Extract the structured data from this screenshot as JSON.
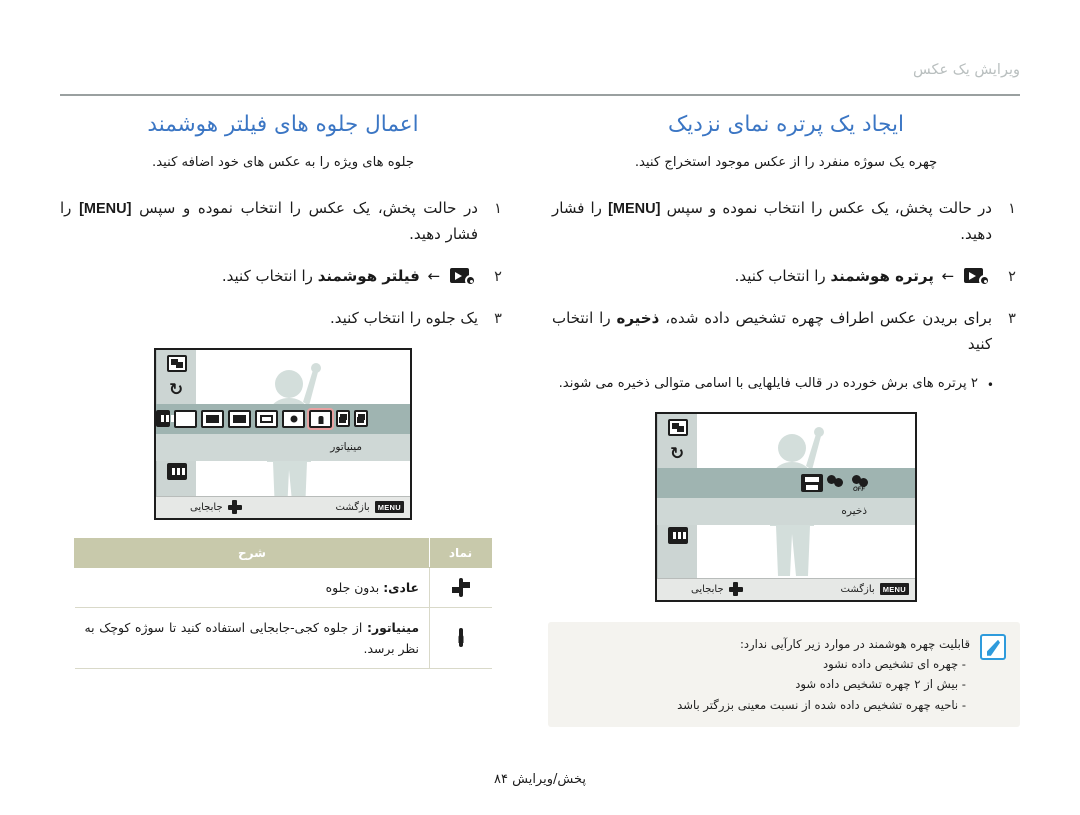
{
  "header": {
    "running_head": "ویرایش یک عکس"
  },
  "right_column": {
    "title": "ایجاد یک پرتره نمای نزدیک",
    "lede": "چهره یک سوژه منفرد را از عکس موجود استخراج کنید.",
    "steps": [
      {
        "num": "۱",
        "text_before": "در حالت پخش، یک عکس را انتخاب نموده و سپس",
        "kbd": "[MENU]",
        "text_after": "را فشار دهید."
      },
      {
        "num": "۲",
        "icon": "play-edit-icon",
        "arrow": "←",
        "bold": "پرتره هوشمند",
        "text_after": "را انتخاب کنید."
      },
      {
        "num": "۳",
        "text_before": "برای بریدن عکس اطراف چهره تشخیص داده شده،",
        "bold": "ذخیره",
        "text_after": "را انتخاب کنید"
      }
    ],
    "sub_bullets": [
      "۲ پرتره های برش خورده در قالب فایلهایی با اسامی متوالی ذخیره می شوند."
    ],
    "lcd": {
      "rail_icons": [
        "crop-icon",
        "rotate-icon",
        "smart-face-icon",
        "smart-filter-icon",
        "piano-icon"
      ],
      "strip_icons": [
        "smart-face-off-icon",
        "smart-face-icon",
        "save-icon"
      ],
      "selected_label": "ذخیره",
      "bottom_left_label": "بازگشت",
      "bottom_left_key": "MENU",
      "bottom_right_label": "جابجایی",
      "bottom_right_key": "dpad-icon"
    },
    "note": {
      "icon": "note-pen-icon",
      "heading": "قابلیت چهره هوشمند در موارد زیر کارآیی ندارد:",
      "items": [
        "- چهره ای تشخیص داده نشود",
        "- بیش از ۲ چهره تشخیص داده شود",
        "- ناحیه چهره تشخیص داده شده از نسبت معینی بزرگتر باشد"
      ]
    }
  },
  "left_column": {
    "title": "اعمال جلوه های فیلتر هوشمند",
    "lede": "جلوه های ویژه را به عکس های خود اضافه کنید.",
    "steps": [
      {
        "num": "۱",
        "text_before": "در حالت پخش، یک عکس را انتخاب نموده و سپس",
        "kbd": "[MENU]",
        "text_after": "را فشار دهید."
      },
      {
        "num": "۲",
        "icon": "play-edit-icon",
        "arrow": "←",
        "bold": "فیلتر هوشمند",
        "text_after": "را انتخاب کنید."
      },
      {
        "num": "۳",
        "text_before": "یک جلوه را انتخاب کنید.",
        "bold": "",
        "text_after": ""
      }
    ],
    "lcd": {
      "rail_icons": [
        "crop-icon",
        "rotate-icon",
        "smart-face-off-icon",
        "smart-filter-off-icon",
        "piano-icon"
      ],
      "strip_icons": [
        "normal-icon",
        "smart-filter-off-icon",
        "miniature-icon",
        "vignetting-icon",
        "soft-focus-icon",
        "old-film1-icon",
        "old-film2-icon",
        "half-tone-icon",
        "classic-icon"
      ],
      "selected_label": "مینیاتور",
      "bottom_left_label": "بازگشت",
      "bottom_left_key": "MENU",
      "bottom_right_label": "جابجایی",
      "bottom_right_key": "dpad-icon"
    },
    "table": {
      "headers": {
        "symbol": "نماد",
        "description": "شرح"
      },
      "rows": [
        {
          "symbol": "normal-icon",
          "bold": "عادی:",
          "desc": "بدون جلوه"
        },
        {
          "symbol": "miniature-icon",
          "bold": "مینیاتور:",
          "desc": "از جلوه کجی-جابجایی استفاده کنید تا سوژه کوچک به نظر برسد."
        }
      ]
    }
  },
  "footer": {
    "text": "پخش/ویرایش  ۸۴"
  },
  "colors": {
    "title_blue": "#3b76c4",
    "header_gray": "#b9bfbf",
    "table_header": "#c8c9ab",
    "note_bg": "#f4f3ef",
    "note_icon_blue": "#2f9bdc",
    "lcd_rail": "#ccd5d3",
    "lcd_strip": "#9fb4b1"
  }
}
